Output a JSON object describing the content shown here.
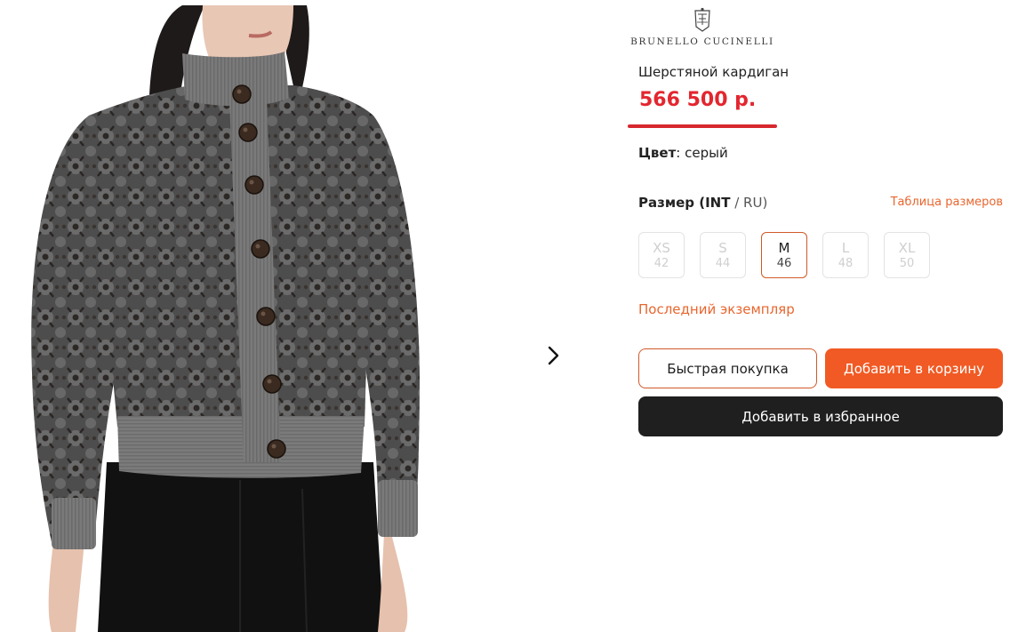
{
  "brand": {
    "name": "BRUNELLO CUCINELLI"
  },
  "product": {
    "title": "Шерстяной кардиган",
    "price": "566 500 р.",
    "color_label": "Цвет",
    "color_value": ": серый",
    "image_icon": "cardigan-photo"
  },
  "size_selector": {
    "label_bold": "Размер (INT",
    "label_separator": " / ",
    "label_rest": "RU)",
    "chart_link": "Таблица размеров",
    "options": [
      {
        "int": "XS",
        "ru": "42",
        "available": false,
        "selected": false
      },
      {
        "int": "S",
        "ru": "44",
        "available": false,
        "selected": false
      },
      {
        "int": "M",
        "ru": "46",
        "available": true,
        "selected": true
      },
      {
        "int": "L",
        "ru": "48",
        "available": false,
        "selected": false
      },
      {
        "int": "XL",
        "ru": "50",
        "available": false,
        "selected": false
      }
    ]
  },
  "stock_note": "Последний экземпляр",
  "actions": {
    "quick_buy": "Быстрая покупка",
    "add_to_cart": "Добавить в корзину",
    "add_to_favorites": "Добавить в избранное"
  },
  "gallery": {
    "next_icon": "chevron-right-icon"
  },
  "colors": {
    "accent": "#f15a24",
    "accent_border": "#d0592a",
    "price": "#e3262f",
    "price_underline": "#d7282f",
    "link": "#e8662e",
    "dark_button": "#1f1f20"
  }
}
